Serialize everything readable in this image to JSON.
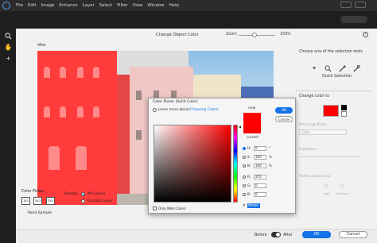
{
  "menu": {
    "items": [
      "File",
      "Edit",
      "Image",
      "Enhance",
      "Layer",
      "Select",
      "Filter",
      "View",
      "Window",
      "Help"
    ]
  },
  "toolbar": {
    "icons": [
      "zoom-icon",
      "hand-icon",
      "add-icon"
    ]
  },
  "dialog": {
    "title": "Change Object Color",
    "zoom_label": "Zoom",
    "zoom_value": "159%",
    "zoom_level": 0.4,
    "help_glyph": "?",
    "preview_label": "After"
  },
  "color_picker_section": {
    "label": "Color Picker",
    "swatches": [
      "1X1",
      "3X3",
      "5X5"
    ],
    "sample_label": "Sample:",
    "options": [
      {
        "label": "All Layers",
        "selected": true
      },
      {
        "label": "Current Layer",
        "selected": false
      }
    ],
    "point_sample_label": "Point Sample"
  },
  "right_panel": {
    "instruction": "Choose one of the selection tools",
    "tool_names": [
      "auto-select-icon",
      "quick-selection-icon",
      "selection-brush-icon",
      "eraser-icon"
    ],
    "selected_tool": "Quick Selection",
    "change_color_label": "Change color to",
    "target_color": "#ff0000",
    "blending_label": "Blending Mode",
    "blending_value": "Color",
    "lightness_label": "Lightness",
    "refine_label": "Refine color area",
    "refine_add": "Add",
    "refine_remove": "Remove"
  },
  "footer": {
    "before_label": "Before",
    "after_label": "After",
    "ok_label": "OK",
    "cancel_label": "Cancel"
  },
  "picker": {
    "title": "Color Picker (Solid Color)",
    "learn_label": "Learn more about:",
    "learn_link": "Choosing Colors",
    "new_label": "new",
    "current_label": "current",
    "ok_label": "OK",
    "cancel_label": "Cancel",
    "new_color": "#ff0000",
    "current_color": "#ff0000",
    "fields": [
      {
        "label": "H:",
        "value": "0",
        "unit": "°",
        "selected": true
      },
      {
        "label": "S:",
        "value": "100",
        "unit": "%",
        "selected": false
      },
      {
        "label": "B:",
        "value": "100",
        "unit": "%",
        "selected": false
      },
      {
        "label": "R:",
        "value": "255",
        "unit": "",
        "selected": false
      },
      {
        "label": "G:",
        "value": "0",
        "unit": "",
        "selected": false
      },
      {
        "label": "B:",
        "value": "0",
        "unit": "",
        "selected": false
      }
    ],
    "hex_label": "#",
    "hex_value": "ff0000",
    "web_colors_label": "Only Web Colors"
  }
}
